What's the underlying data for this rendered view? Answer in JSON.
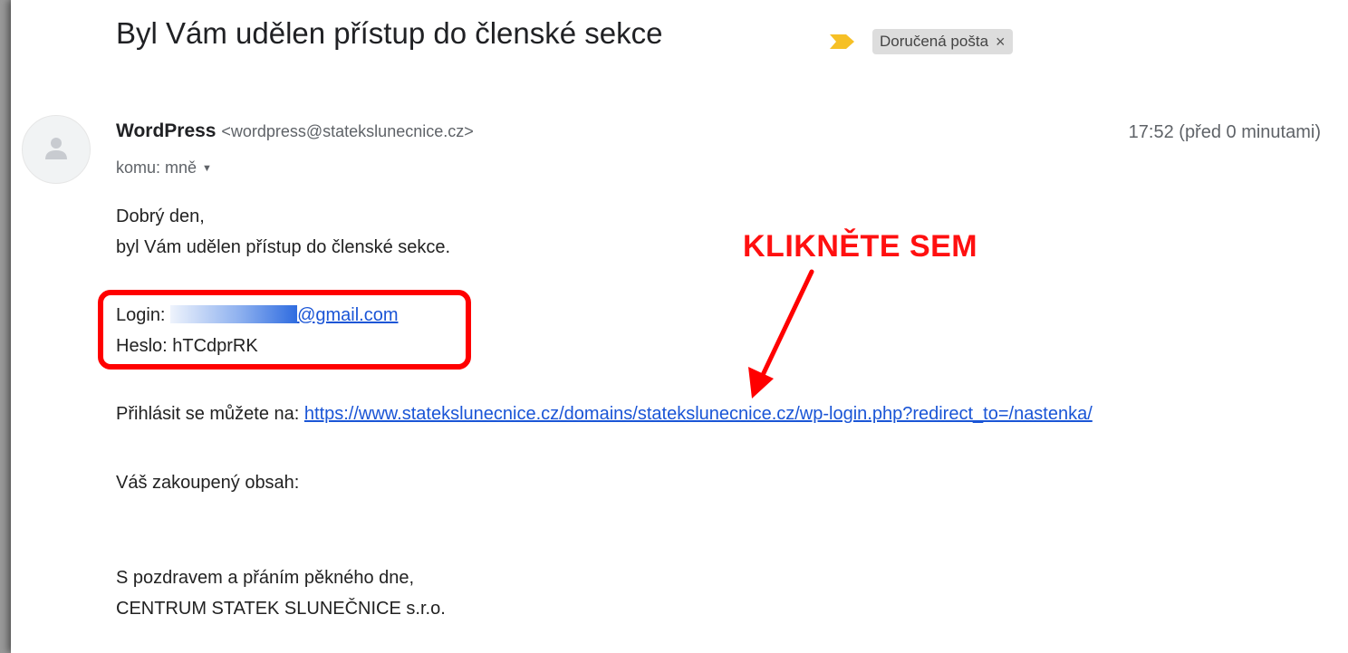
{
  "email": {
    "subject": "Byl Vám udělen přístup do členské sekce",
    "label": "Doručená pošta",
    "label_close": "×",
    "sender_name": "WordPress",
    "sender_email": "<wordpress@statekslunecnice.cz>",
    "timestamp": "17:52 (před 0 minutami)",
    "recipient": "komu: mně",
    "icons": {
      "important": "important-marker-icon",
      "avatar": "person-icon",
      "caret": "chevron-down-icon"
    },
    "colors": {
      "important": "#f6c026",
      "link": "#1a55d6",
      "annotation": "#ff0000"
    }
  },
  "body": {
    "greeting": "Dobrý den,",
    "intro": "byl Vám udělen přístup do členské sekce.",
    "login_label": "Login:",
    "login_value_visible": "@gmail.com",
    "password_line": "Heslo: hTCdprRK",
    "login_prefix": "Přihlásit se můžete na:",
    "login_url": "https://www.statekslunecnice.cz/domains/statekslunecnice.cz/wp-login.php?redirect_to=/nastenka/",
    "purchased": "Váš zakoupený obsah:",
    "closing": "S pozdravem a přáním pěkného dne,",
    "company": "CENTRUM STATEK SLUNEČNICE s.r.o."
  },
  "annotation": {
    "text": "KLIKNĚTE SEM"
  }
}
